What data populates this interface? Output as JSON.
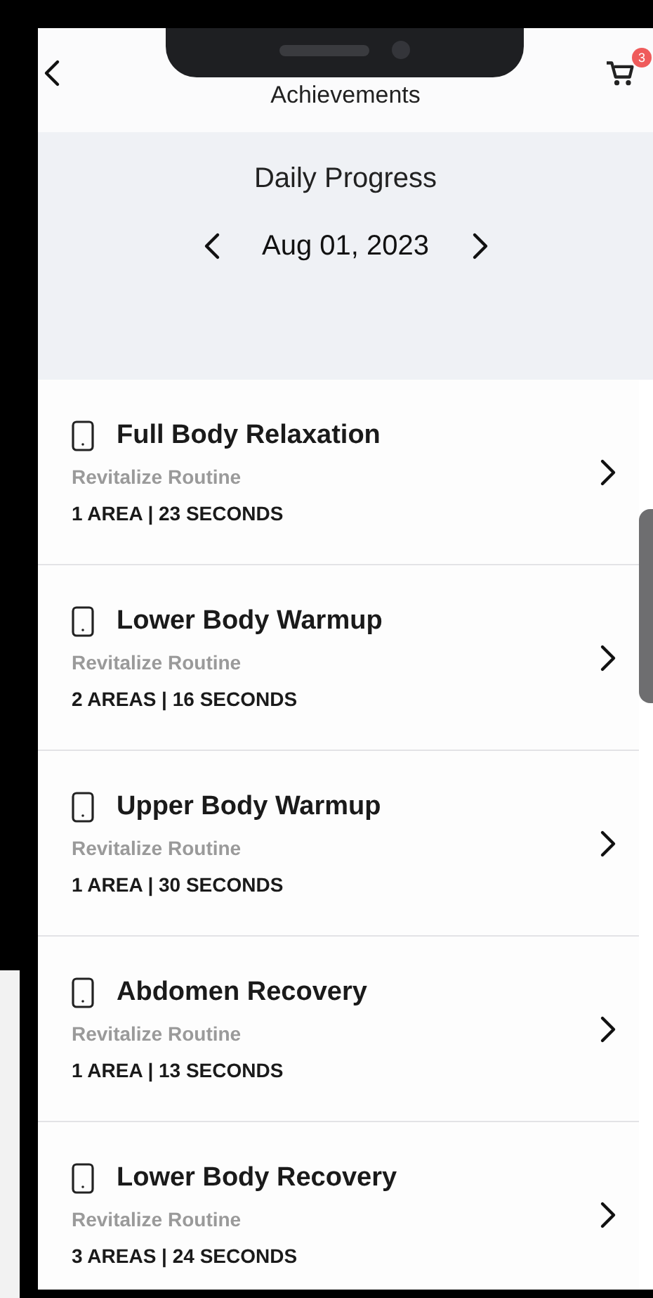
{
  "header": {
    "title": "Achievements",
    "cart_badge": "3"
  },
  "progress": {
    "title": "Daily Progress",
    "date": "Aug 01, 2023"
  },
  "routines": [
    {
      "name": "Full Body Relaxation",
      "category": "Revitalize Routine",
      "details": "1 AREA | 23 SECONDS"
    },
    {
      "name": "Lower Body Warmup",
      "category": "Revitalize Routine",
      "details": "2 AREAS | 16 SECONDS"
    },
    {
      "name": "Upper Body Warmup",
      "category": "Revitalize Routine",
      "details": "1 AREA | 30 SECONDS"
    },
    {
      "name": "Abdomen Recovery",
      "category": "Revitalize Routine",
      "details": "1 AREA | 13 SECONDS"
    },
    {
      "name": "Lower Body Recovery",
      "category": "Revitalize Routine",
      "details": "3 AREAS | 24 SECONDS"
    }
  ]
}
